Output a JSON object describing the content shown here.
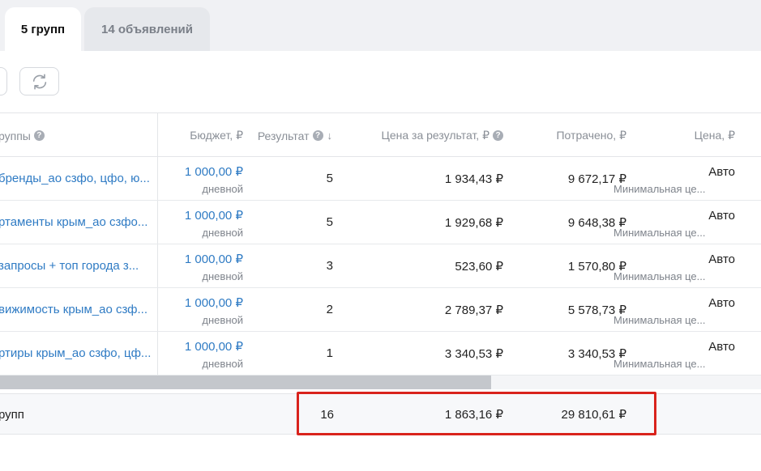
{
  "tabs": [
    {
      "label": "5 групп",
      "active": true
    },
    {
      "label": "14 объявлений",
      "active": false
    }
  ],
  "toolbar": {
    "refresh_icon": "refresh-icon"
  },
  "table": {
    "headers": {
      "name": "руппы",
      "budget": "Бюджет, ₽",
      "result": "Результат",
      "cost_per_result": "Цена за результат, ₽",
      "spent": "Потрачено, ₽",
      "bid": "Цена, ₽"
    },
    "rows": [
      {
        "name": "бренды_ао сзфо, цфо, ю...",
        "budget": "1 000,00 ₽",
        "period": "дневной",
        "result": "5",
        "cost_per_result": "1 934,43 ₽",
        "spent": "9 672,17 ₽",
        "bid": "Авто",
        "bid_note": "Минимальная це..."
      },
      {
        "name": "ртаменты крым_ао сзфо...",
        "budget": "1 000,00 ₽",
        "period": "дневной",
        "result": "5",
        "cost_per_result": "1 929,68 ₽",
        "spent": "9 648,38 ₽",
        "bid": "Авто",
        "bid_note": "Минимальная це..."
      },
      {
        "name": "запросы + топ города з...",
        "budget": "1 000,00 ₽",
        "period": "дневной",
        "result": "3",
        "cost_per_result": "523,60 ₽",
        "spent": "1 570,80 ₽",
        "bid": "Авто",
        "bid_note": "Минимальная це..."
      },
      {
        "name": "вижимость крым_ао сзф...",
        "budget": "1 000,00 ₽",
        "period": "дневной",
        "result": "2",
        "cost_per_result": "2 789,37 ₽",
        "spent": "5 578,73 ₽",
        "bid": "Авто",
        "bid_note": "Минимальная це..."
      },
      {
        "name": "ртиры крым_ао сзфо, цф...",
        "budget": "1 000,00 ₽",
        "period": "дневной",
        "result": "1",
        "cost_per_result": "3 340,53 ₽",
        "spent": "3 340,53 ₽",
        "bid": "Авто",
        "bid_note": "Минимальная це..."
      }
    ],
    "totals": {
      "label": "рупп",
      "result": "16",
      "cost_per_result": "1 863,16 ₽",
      "spent": "29 810,61 ₽"
    }
  },
  "colors": {
    "link": "#2f7bc4",
    "highlight": "#d9231c"
  }
}
